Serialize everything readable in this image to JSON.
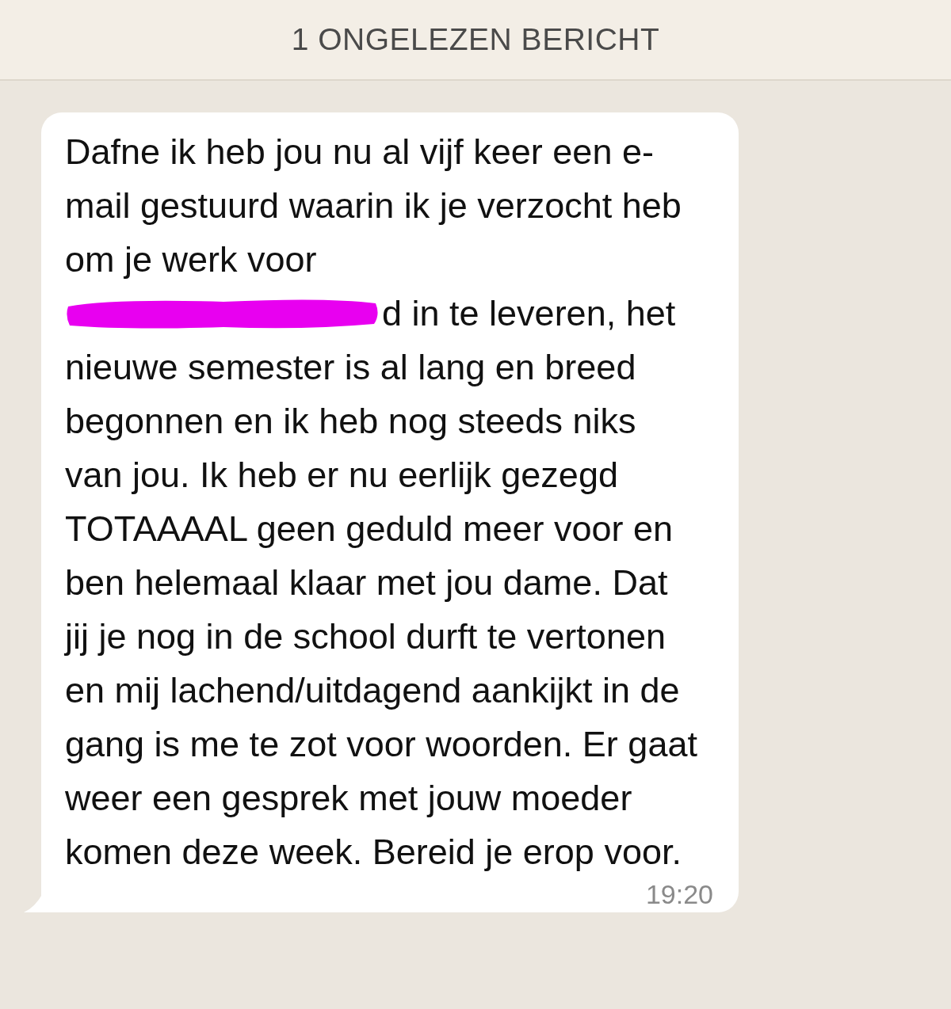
{
  "unread_banner": {
    "label": "1 ONGELEZEN BERICHT"
  },
  "message": {
    "text_before": "Dafne ik heb jou nu al vijf keer een e-mail gestuurd waarin ik je verzocht heb om je werk voor",
    "redacted_line_tail": "d in te leveren, het",
    "text_after": "nieuwe semester is al lang en breed begonnen en ik heb nog steeds niks van jou. Ik heb er nu eerlijk gezegd TOTAAAAL geen geduld meer voor en ben helemaal klaar met jou dame. Dat jij je nog in de school durft te vertonen en mij lachend/uitdagend aankijkt in de gang is me te zot voor woorden. Er gaat weer een gesprek met jouw moeder komen deze week. Bereid je erop voor.",
    "time": "19:20"
  }
}
